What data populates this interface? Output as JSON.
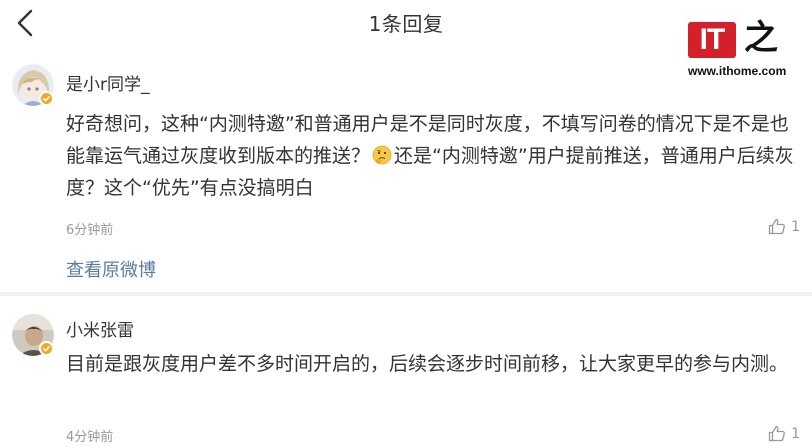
{
  "header": {
    "title": "1条回复"
  },
  "watermark": {
    "logo_text": "IT",
    "logo_char": "之",
    "url": "www.ithome.com"
  },
  "comments": [
    {
      "username": "是小r同学_",
      "text_before_emoji": "好奇想问，这种“内测特邀”和普通用户是不是同时灰度，不填写问卷的情况下是不是也能靠运气通过灰度收到版本的推送？",
      "emoji": "thinking-emoji",
      "text_after_emoji": "还是“内测特邀”用户提前推送，普通用户后续灰度？这个“优先”有点没搞明白",
      "time": "6分钟前",
      "likes": "1",
      "view_original": "查看原微博"
    },
    {
      "username": "小米张雷",
      "text": "目前是跟灰度用户差不多时间开启的，后续会逐步时间前移，让大家更早的参与内测。",
      "time": "4分钟前",
      "likes": "1"
    }
  ],
  "colors": {
    "link": "#5b7ba6",
    "muted": "#999999",
    "badge": "#f5a623",
    "watermark_red": "#d3212c"
  }
}
